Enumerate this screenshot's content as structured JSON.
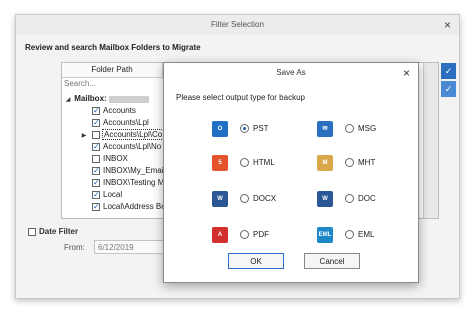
{
  "filter_window": {
    "title": "Filter Selection",
    "close_glyph": "×",
    "header": "Review and search Mailbox Folders to Migrate",
    "column_header": "Folder Path",
    "search_placeholder": "Search...",
    "tree": [
      {
        "label": "Mailbox:",
        "bold": true,
        "arrow": "◢",
        "checked": null
      },
      {
        "label": "Accounts",
        "checked": true
      },
      {
        "label": "Accounts\\Lpl",
        "checked": true
      },
      {
        "label": "Accounts\\Lpl\\Co",
        "checked": false,
        "selected": true,
        "arrow": "▶"
      },
      {
        "label": "Accounts\\Lpl\\No",
        "checked": true
      },
      {
        "label": "INBOX",
        "checked": false
      },
      {
        "label": "INBOX\\My_Email",
        "checked": true
      },
      {
        "label": "INBOX\\Testing M",
        "checked": true
      },
      {
        "label": "Local",
        "checked": true
      },
      {
        "label": "Local\\Address Bo",
        "checked": true
      }
    ],
    "date_filter_label": "Date Filter",
    "from_label": "From:",
    "from_value": "6/12/2019",
    "side_buttons": [
      "check-all-icon",
      "uncheck-all-icon"
    ]
  },
  "save_as": {
    "title": "Save As",
    "close_glyph": "×",
    "prompt": "Please select output type for backup",
    "options": [
      {
        "label": "PST",
        "icon": "outlook-icon",
        "color": "#1f6fc5",
        "selected": true
      },
      {
        "label": "MSG",
        "icon": "envelope-icon",
        "color": "#2a6fc0",
        "selected": false
      },
      {
        "label": "HTML",
        "icon": "html5-icon",
        "color": "#e5532d",
        "selected": false
      },
      {
        "label": "MHT",
        "icon": "mht-icon",
        "color": "#d9a84a",
        "selected": false
      },
      {
        "label": "DOCX",
        "icon": "word-docx-icon",
        "color": "#2b5797",
        "selected": false
      },
      {
        "label": "DOC",
        "icon": "word-doc-icon",
        "color": "#2b5797",
        "selected": false
      },
      {
        "label": "PDF",
        "icon": "pdf-icon",
        "color": "#d32f2f",
        "selected": false
      },
      {
        "label": "EML",
        "icon": "eml-icon",
        "color": "#1e88c7",
        "selected": false
      }
    ],
    "ok_label": "OK",
    "cancel_label": "Cancel"
  }
}
